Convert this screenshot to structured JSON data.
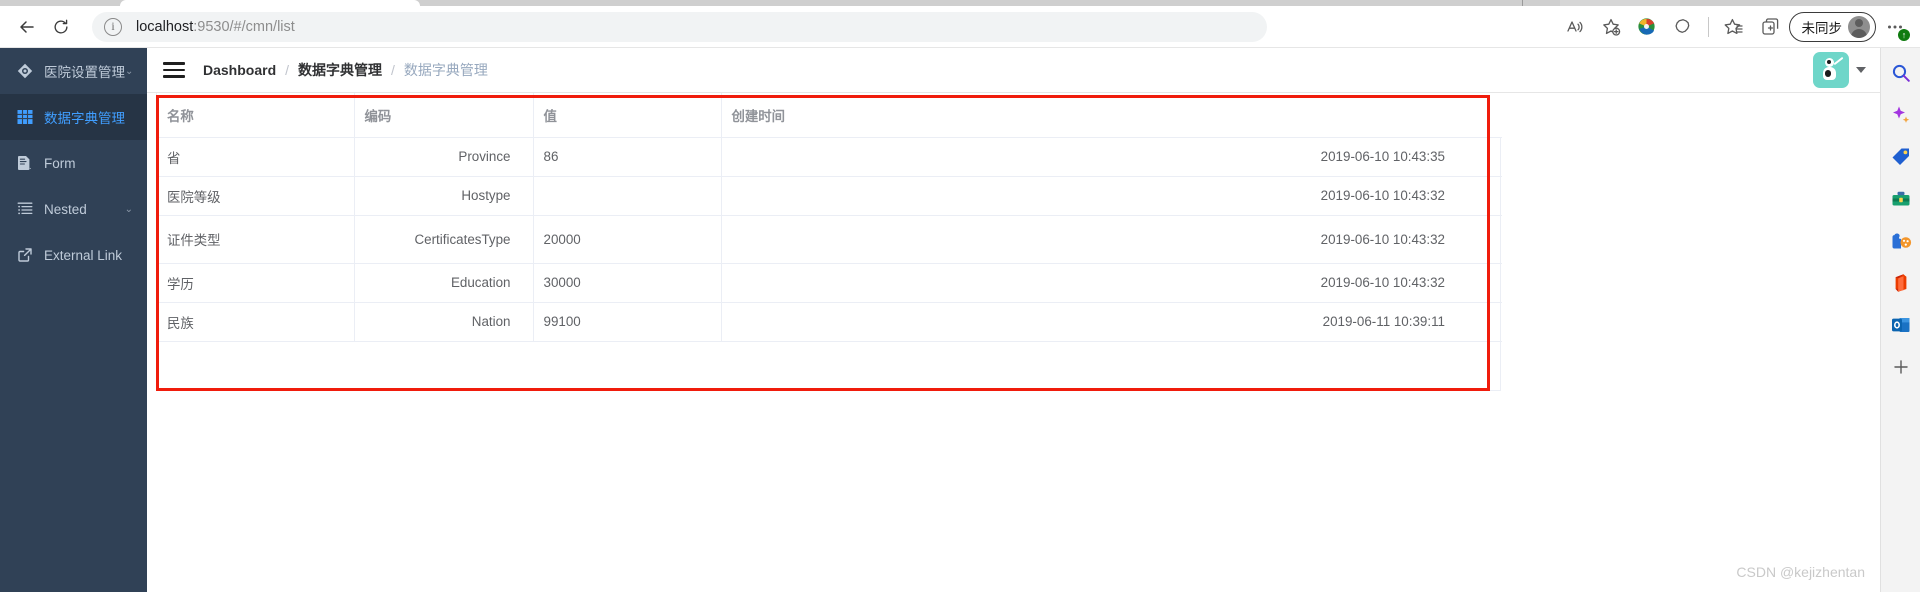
{
  "browser": {
    "back_icon": "back-arrow-icon",
    "reload_icon": "reload-icon",
    "url": "localhost:9530/#/cmn/list",
    "url_host": "localhost",
    "url_rest": ":9530/#/cmn/list",
    "actions": [
      {
        "name": "read-aloud-icon",
        "label": "A"
      },
      {
        "name": "add-favorite-icon",
        "label": "☆"
      },
      {
        "name": "extension-idm-icon",
        "label": "IDM"
      },
      {
        "name": "split-screen-icon",
        "label": "⬠"
      },
      {
        "name": "favorites-icon",
        "label": "☆"
      },
      {
        "name": "collections-icon",
        "label": "⊞"
      }
    ],
    "profile_label": "未同步",
    "more_label": "…",
    "more_badge": "↑"
  },
  "edge_rail": {
    "items": [
      {
        "name": "search-icon",
        "label": "search"
      },
      {
        "name": "copilot-sparkle-icon",
        "label": "copilot"
      },
      {
        "name": "shopping-tag-icon",
        "label": "shopping"
      },
      {
        "name": "tools-toolbox-icon",
        "label": "tools"
      },
      {
        "name": "games-icon",
        "label": "games"
      },
      {
        "name": "office-icon",
        "label": "office"
      },
      {
        "name": "outlook-icon",
        "label": "outlook"
      },
      {
        "name": "add-sidebar-icon",
        "label": "+"
      }
    ]
  },
  "sidebar": {
    "items": [
      {
        "label": "医院设置管理",
        "icon": "settings-diamond-icon",
        "active": false,
        "caret": "⌄"
      },
      {
        "label": "数据字典管理",
        "icon": "grid-table-icon",
        "active": true,
        "caret": ""
      },
      {
        "label": "Form",
        "icon": "form-document-icon",
        "active": false,
        "caret": ""
      },
      {
        "label": "Nested",
        "icon": "nested-list-icon",
        "active": false,
        "caret": "⌄"
      },
      {
        "label": "External Link",
        "icon": "external-link-icon",
        "active": false,
        "caret": ""
      }
    ]
  },
  "header": {
    "hamburger_icon": "hamburger-menu-icon",
    "breadcrumb": [
      {
        "label": "Dashboard",
        "current": false
      },
      {
        "label": "数据字典管理",
        "current": false
      },
      {
        "label": "数据字典管理",
        "current": true
      }
    ],
    "separator": "/",
    "avatar_icon": "user-avatar-icon",
    "caret_icon": "chevron-down-icon"
  },
  "table": {
    "columns": [
      {
        "key": "name",
        "label": "名称"
      },
      {
        "key": "code",
        "label": "编码"
      },
      {
        "key": "value",
        "label": "值"
      },
      {
        "key": "time",
        "label": "创建时间"
      }
    ],
    "rows": [
      {
        "name": "省",
        "code": "Province",
        "value": "86",
        "time": "2019-06-10 10:43:35"
      },
      {
        "name": "医院等级",
        "code": "Hostype",
        "value": "",
        "time": "2019-06-10 10:43:32"
      },
      {
        "name": "证件类型",
        "code": "CertificatesType",
        "value": "20000",
        "time": "2019-06-10 10:43:32"
      },
      {
        "name": "学历",
        "code": "Education",
        "value": "30000",
        "time": "2019-06-10 10:43:32"
      },
      {
        "name": "民族",
        "code": "Nation",
        "value": "99100",
        "time": "2019-06-11 10:39:11"
      }
    ]
  },
  "annotation": {
    "color": "#f01c0c"
  },
  "watermark": {
    "text": "CSDN @kejizhentan"
  }
}
